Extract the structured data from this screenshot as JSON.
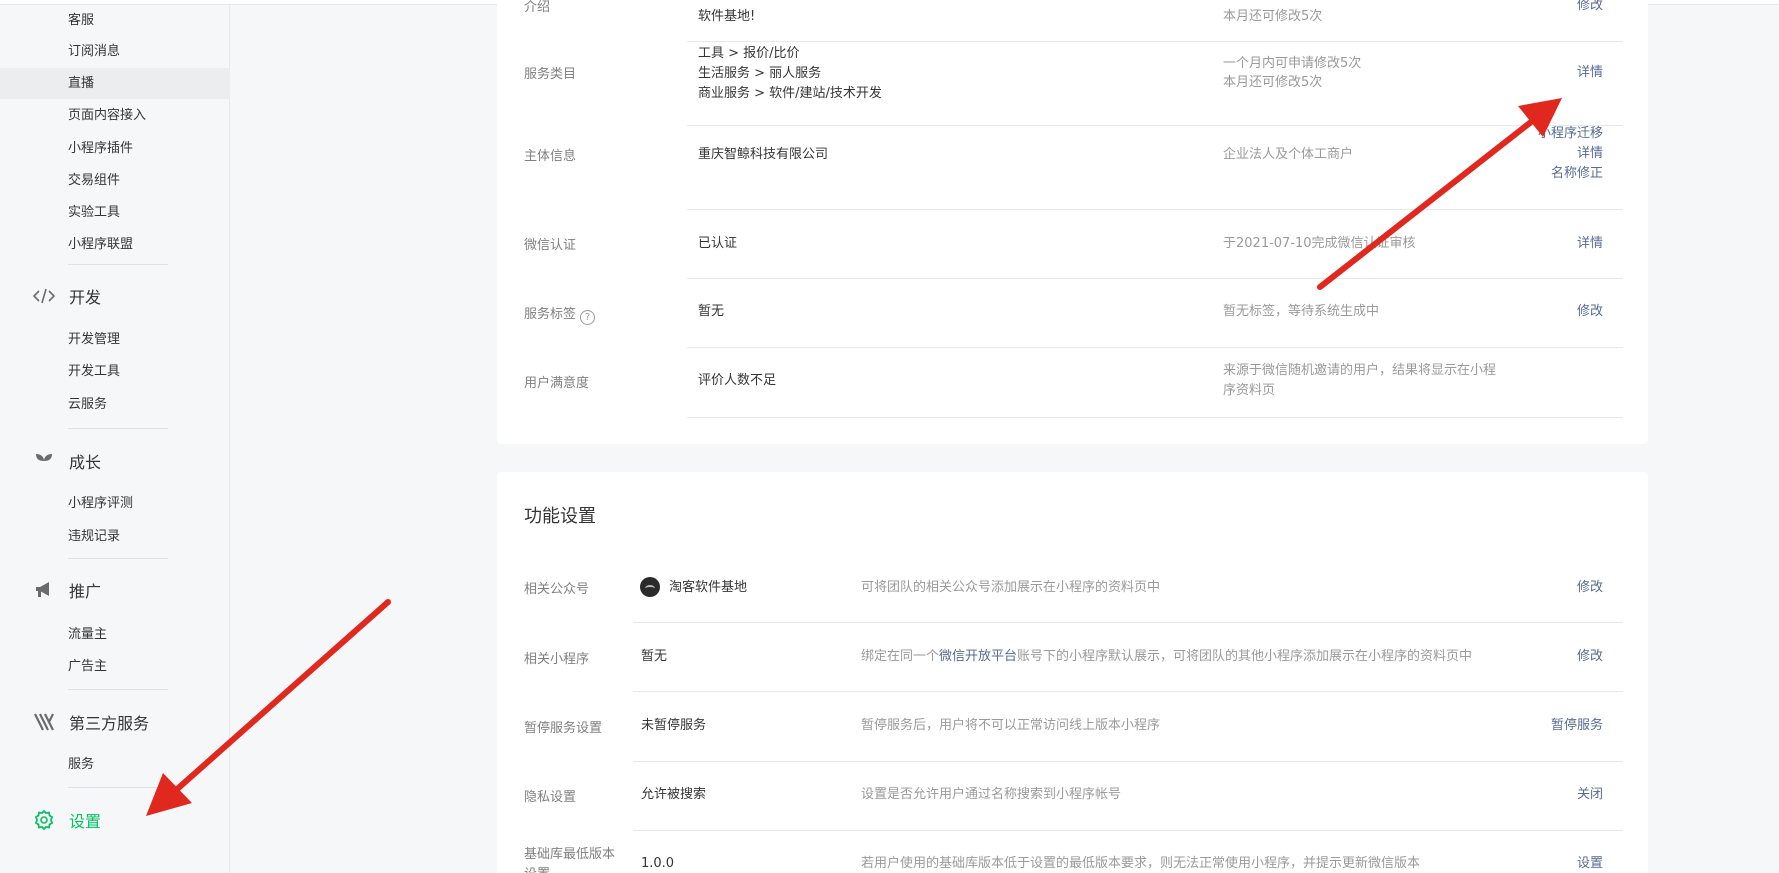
{
  "sidebar": {
    "items_top": [
      "客服",
      "订阅消息",
      "直播",
      "页面内容接入",
      "小程序插件",
      "交易组件",
      "实验工具",
      "小程序联盟"
    ],
    "dev": {
      "label": "开发",
      "items": [
        "开发管理",
        "开发工具",
        "云服务"
      ]
    },
    "growth": {
      "label": "成长",
      "items": [
        "小程序评测",
        "违规记录"
      ]
    },
    "promo": {
      "label": "推广",
      "items": [
        "流量主",
        "广告主"
      ]
    },
    "third": {
      "label": "第三方服务",
      "items": [
        "服务"
      ]
    },
    "settings": {
      "label": "设置"
    }
  },
  "info": {
    "intro": {
      "label": "介绍",
      "value": "软件基地!",
      "desc": "本月还可修改5次",
      "action": "修改"
    },
    "category": {
      "label": "服务类目",
      "values": [
        "工具 > 报价/比价",
        "生活服务 > 丽人服务",
        "商业服务 > 软件/建站/技术开发"
      ],
      "desc1": "一个月内可申请修改5次",
      "desc2": "本月还可修改5次",
      "action": "详情"
    },
    "subject": {
      "label": "主体信息",
      "value": "重庆智鲸科技有限公司",
      "desc": "企业法人及个体工商户",
      "actions": [
        "小程序迁移",
        "详情",
        "名称修正"
      ]
    },
    "wechat_cert": {
      "label": "微信认证",
      "value": "已认证",
      "desc": "于2021-07-10完成微信认证审核",
      "action": "详情"
    },
    "service_tag": {
      "label": "服务标签",
      "help": "?",
      "value": "暂无",
      "desc": "暂无标签，等待系统生成中",
      "action": "修改"
    },
    "satisfaction": {
      "label": "用户满意度",
      "value": "评价人数不足",
      "desc1": "来源于微信随机邀请的用户，结果将显示在小程",
      "desc2": "序资料页"
    }
  },
  "features": {
    "title": "功能设置",
    "official": {
      "label": "相关公众号",
      "value": "淘客软件基地",
      "desc": "可将团队的相关公众号添加展示在小程序的资料页中",
      "action": "修改"
    },
    "related_mp": {
      "label": "相关小程序",
      "value": "暂无",
      "desc_pre": "绑定在同一个",
      "desc_link": "微信开放平台",
      "desc_post": "账号下的小程序默认展示，可将团队的其他小程序添加展示在小程序的资料页中",
      "action": "修改"
    },
    "pause": {
      "label": "暂停服务设置",
      "value": "未暂停服务",
      "desc": "暂停服务后，用户将不可以正常访问线上版本小程序",
      "action": "暂停服务"
    },
    "privacy": {
      "label": "隐私设置",
      "value": "允许被搜索",
      "desc": "设置是否允许用户通过名称搜索到小程序帐号",
      "action": "关闭"
    },
    "min_lib": {
      "label1": "基础库最低版本",
      "label2": "设置",
      "value": "1.0.0",
      "desc": "若用户使用的基础库版本低于设置的最低版本要求，则无法正常使用小程序，并提示更新微信版本",
      "action": "设置"
    }
  },
  "colors": {
    "accent_green": "#07c160",
    "link_blue": "#576b95",
    "arrow_red": "#e0281e"
  }
}
